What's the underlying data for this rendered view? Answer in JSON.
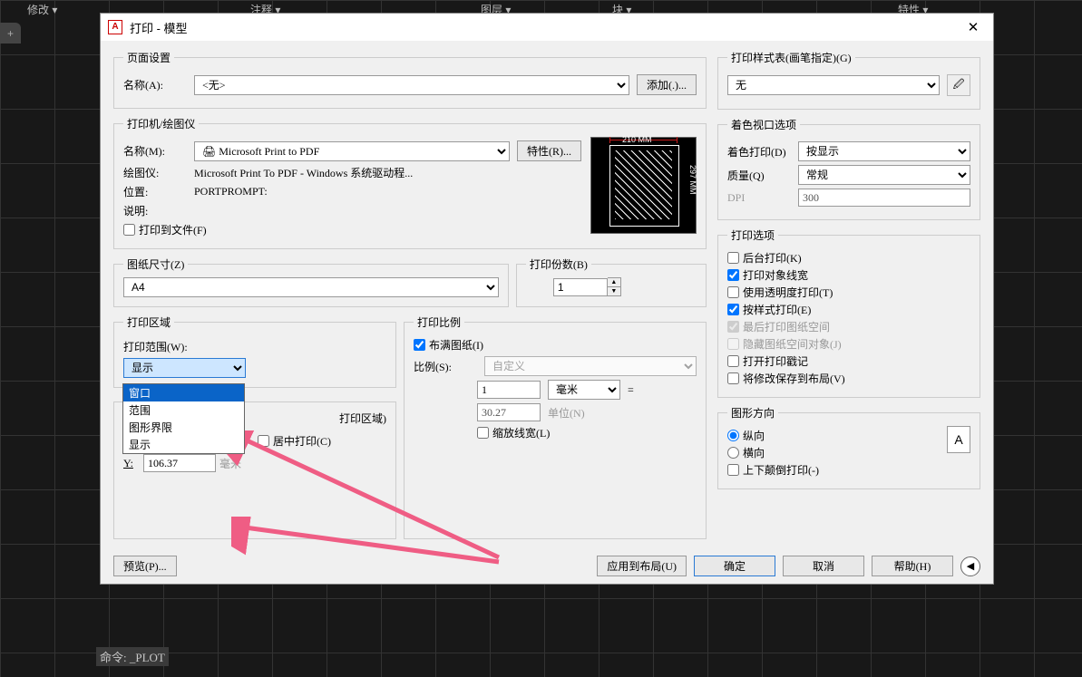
{
  "topbar": {
    "modify": "修改 ▾",
    "annotate": "注释 ▾",
    "layers": "图层 ▾",
    "block": "块 ▾",
    "properties": "特性 ▾"
  },
  "dialog": {
    "title": "打印 - 模型"
  },
  "page_setup": {
    "legend": "页面设置",
    "name_label": "名称(A):",
    "name_value": "<无>",
    "add_btn": "添加(.)..."
  },
  "printer": {
    "legend": "打印机/绘图仪",
    "name_label": "名称(M):",
    "name_value": "Microsoft Print to PDF",
    "props_btn": "特性(R)...",
    "plotter_label": "绘图仪:",
    "plotter_value": "Microsoft Print To PDF - Windows 系统驱动程...",
    "where_label": "位置:",
    "where_value": "PORTPROMPT:",
    "desc_label": "说明:",
    "to_file": "打印到文件(F)",
    "paper_w": "210 MM",
    "paper_h": "297 MM"
  },
  "paper": {
    "legend": "图纸尺寸(Z)",
    "value": "A4"
  },
  "copies": {
    "legend": "打印份数(B)",
    "value": "1"
  },
  "area": {
    "legend": "打印区域",
    "what_label": "打印范围(W):",
    "selected": "显示",
    "options": [
      "窗口",
      "范围",
      "图形界限",
      "显示"
    ]
  },
  "offset": {
    "hint": "打印区域)",
    "center": "居中打印(C)",
    "y_label": "Y:",
    "y_value": "106.37",
    "unit": "毫米"
  },
  "scale": {
    "legend": "打印比例",
    "fit": "布满图纸(I)",
    "scale_label": "比例(S):",
    "scale_value": "自定义",
    "num": "1",
    "unit1": "毫米",
    "den": "30.27",
    "unit2": "单位(N)",
    "lineweights": "缩放线宽(L)"
  },
  "style": {
    "legend": "打印样式表(画笔指定)(G)",
    "value": "无"
  },
  "shaded": {
    "legend": "着色视口选项",
    "shade_label": "着色打印(D)",
    "shade_value": "按显示",
    "quality_label": "质量(Q)",
    "quality_value": "常规",
    "dpi_label": "DPI",
    "dpi_value": "300"
  },
  "options": {
    "legend": "打印选项",
    "items": [
      "后台打印(K)",
      "打印对象线宽",
      "使用透明度打印(T)",
      "按样式打印(E)",
      "最后打印图纸空间",
      "隐藏图纸空间对象(J)",
      "打开打印戳记",
      "将修改保存到布局(V)"
    ]
  },
  "orient": {
    "legend": "图形方向",
    "portrait": "纵向",
    "landscape": "横向",
    "upside": "上下颠倒打印(-)"
  },
  "footer": {
    "preview": "预览(P)...",
    "apply": "应用到布局(U)",
    "ok": "确定",
    "cancel": "取消",
    "help": "帮助(H)"
  },
  "cmd": {
    "prompt": "命令: ",
    "text": "_PLOT"
  }
}
